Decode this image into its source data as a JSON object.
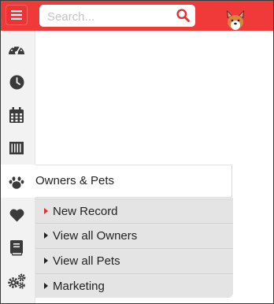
{
  "header": {
    "search_placeholder": "Search...",
    "menu_icon": "hamburger-icon",
    "search_icon": "magnifier-icon",
    "avatar_icon": "dog-avatar-icon"
  },
  "sidebar": {
    "items": [
      {
        "icon": "dashboard-gauge-icon"
      },
      {
        "icon": "clock-icon"
      },
      {
        "icon": "calendar-icon"
      },
      {
        "icon": "barcode-icon"
      },
      {
        "icon": "paw-icon",
        "active": true
      },
      {
        "icon": "heart-icon"
      },
      {
        "icon": "book-icon"
      },
      {
        "icon": "gears-icon"
      }
    ]
  },
  "flyout": {
    "title": "Owners & Pets",
    "items": [
      {
        "label": "New Record",
        "highlighted": true
      },
      {
        "label": "View all Owners"
      },
      {
        "label": "View all Pets"
      },
      {
        "label": "Marketing"
      }
    ]
  },
  "colors": {
    "brand": "#f03a3a",
    "sidebar_bg": "#f2f2f2",
    "submenu_bg": "#e4e4e4",
    "icon": "#3a3a3a"
  }
}
